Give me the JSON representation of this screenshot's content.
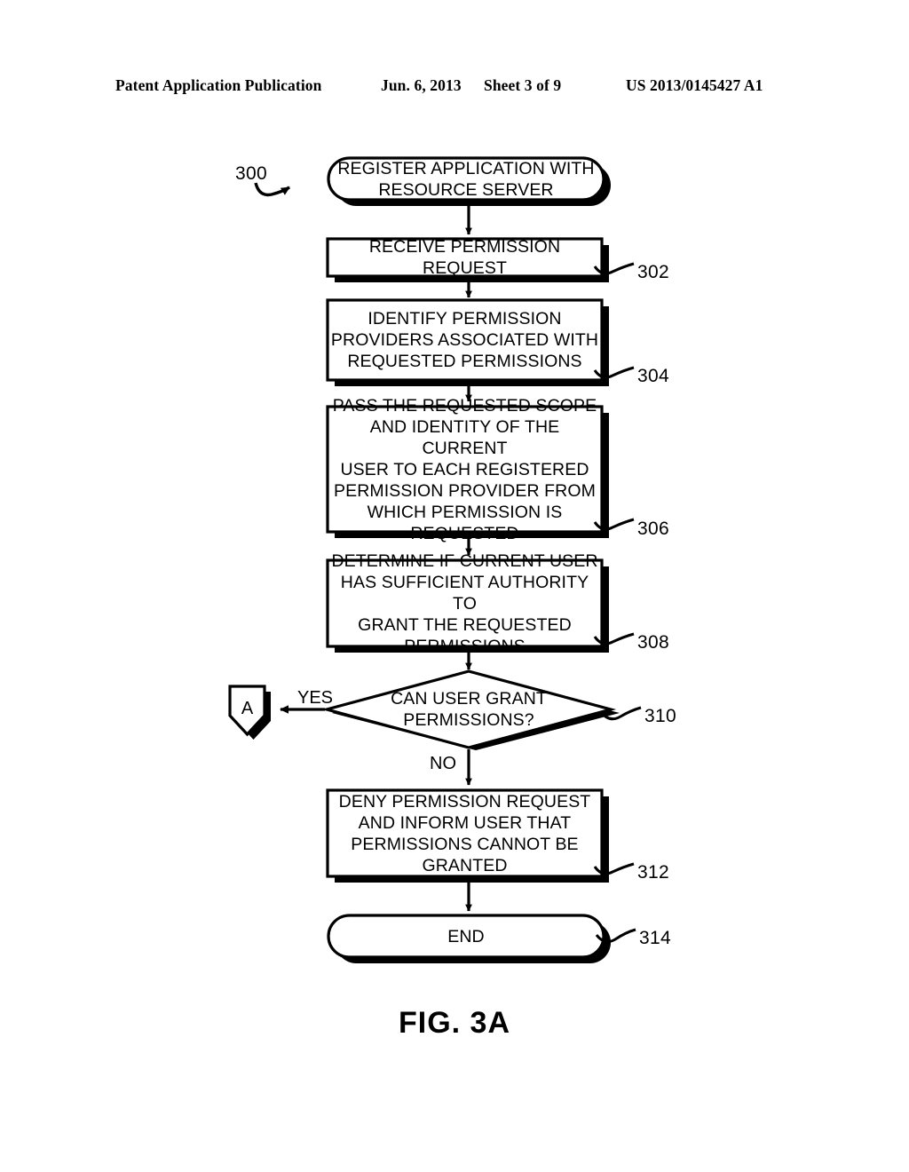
{
  "header": {
    "publication": "Patent Application Publication",
    "date": "Jun. 6, 2013",
    "sheet": "Sheet 3 of 9",
    "patent_number": "US 2013/0145427 A1"
  },
  "figure": {
    "caption": "FIG. 3A",
    "diagram_label": "300",
    "connector_letter": "A",
    "ink_color": "#000000",
    "background_color": "#ffffff"
  },
  "flowchart": {
    "nodes": [
      {
        "id": "start",
        "shape": "rounded-terminator",
        "text": "REGISTER APPLICATION WITH\nRESOURCE SERVER",
        "ref": "300"
      },
      {
        "id": "step-302",
        "shape": "process",
        "text": "RECEIVE PERMISSION REQUEST",
        "ref": "302"
      },
      {
        "id": "step-304",
        "shape": "process",
        "text": "IDENTIFY PERMISSION\nPROVIDERS ASSOCIATED WITH\nREQUESTED PERMISSIONS",
        "ref": "304"
      },
      {
        "id": "step-306",
        "shape": "process",
        "text": "PASS THE REQUESTED SCOPE\nAND IDENTITY OF THE CURRENT\nUSER TO EACH REGISTERED\nPERMISSION PROVIDER FROM\nWHICH PERMISSION IS\nREQUESTED",
        "ref": "306"
      },
      {
        "id": "step-308",
        "shape": "process",
        "text": "DETERMINE IF CURRENT USER\nHAS SUFFICIENT AUTHORITY TO\nGRANT THE REQUESTED\nPERMISSIONS",
        "ref": "308"
      },
      {
        "id": "decision-310",
        "shape": "decision",
        "text": "CAN USER GRANT\nPERMISSIONS?",
        "ref": "310"
      },
      {
        "id": "step-312",
        "shape": "process",
        "text": "DENY PERMISSION REQUEST\nAND INFORM USER THAT\nPERMISSIONS CANNOT BE\nGRANTED",
        "ref": "312"
      },
      {
        "id": "end",
        "shape": "rounded-terminator",
        "text": "END",
        "ref": "314"
      },
      {
        "id": "offpage-connector-a",
        "shape": "pentagon-connector",
        "text": "A",
        "ref": ""
      }
    ],
    "edges": [
      {
        "from": "start",
        "to": "step-302",
        "label": ""
      },
      {
        "from": "step-302",
        "to": "step-304",
        "label": ""
      },
      {
        "from": "step-304",
        "to": "step-306",
        "label": ""
      },
      {
        "from": "step-306",
        "to": "step-308",
        "label": ""
      },
      {
        "from": "step-308",
        "to": "decision-310",
        "label": ""
      },
      {
        "from": "decision-310",
        "to": "offpage-connector-a",
        "label": "YES"
      },
      {
        "from": "decision-310",
        "to": "step-312",
        "label": "NO"
      },
      {
        "from": "step-312",
        "to": "end",
        "label": ""
      }
    ],
    "labels": {
      "yes": "YES",
      "no": "NO"
    }
  }
}
